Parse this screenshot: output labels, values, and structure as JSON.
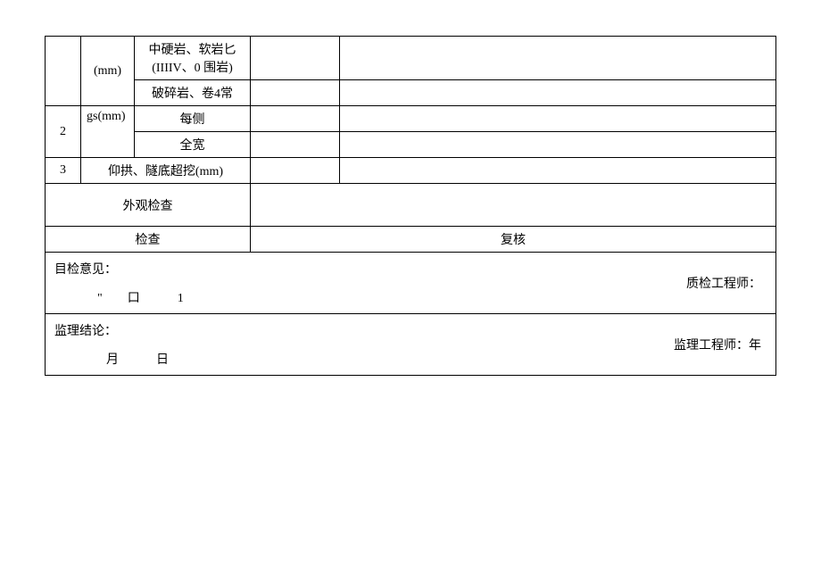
{
  "table": {
    "row1": {
      "unit": "(mm)",
      "desc1": "中硬岩、软岩匕",
      "desc2": "(IIIIV、0 围岩)"
    },
    "row2": {
      "desc": "破碎岩、卷4常"
    },
    "row3": {
      "idx": "2",
      "sub": "gs(mm)",
      "desc_a": "每侧",
      "desc_b": "全宽"
    },
    "row4": {
      "idx": "3",
      "desc": "仰拱、隧底超挖(mm)"
    },
    "row5": {
      "label": "外观检查"
    },
    "row6": {
      "left": "检查",
      "right": "复核"
    }
  },
  "opinion": {
    "title": "目检意见：",
    "marks": "\"　　口　　　1",
    "signer": "质检工程师："
  },
  "conclusion": {
    "title": "监理结论：",
    "date": "月　　　日",
    "signer": "监理工程师：年"
  }
}
